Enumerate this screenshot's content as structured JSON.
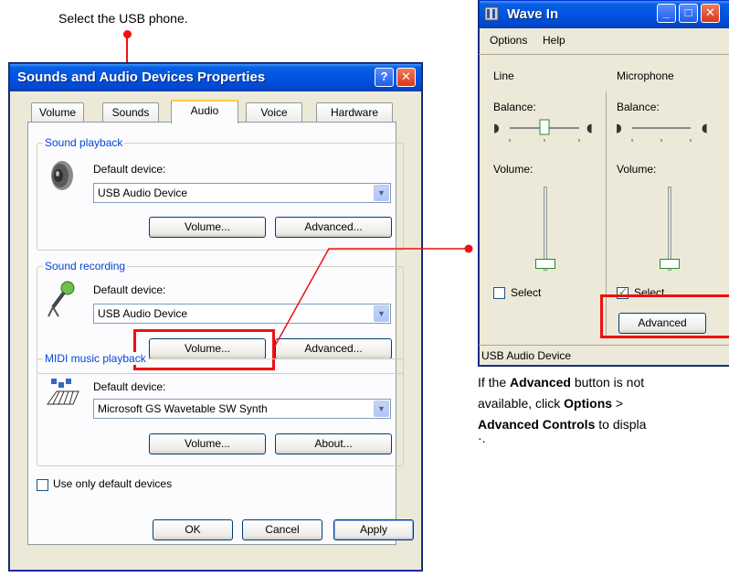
{
  "callouts": {
    "top_instruction": "Select the USB phone.",
    "note_parts": {
      "p1": "If the ",
      "advanced": "Advanced",
      "p2": " button is not",
      "p3": "available, click ",
      "options": "Options",
      "p4": " >",
      "advanced_controls": "Advanced Controls",
      "p5": " to displa",
      "p6": "·."
    }
  },
  "dialog": {
    "title": "Sounds and Audio Devices Properties",
    "help_btn": "?",
    "close_btn": "✕",
    "tabs": [
      "Volume",
      "Sounds",
      "Audio",
      "Voice",
      "Hardware"
    ],
    "active_tab": "Audio",
    "playback": {
      "label": "Sound playback",
      "default_label": "Default device:",
      "device": "USB Audio Device",
      "volume_btn": "Volume...",
      "advanced_btn": "Advanced..."
    },
    "recording": {
      "label": "Sound recording",
      "default_label": "Default device:",
      "device": "USB Audio Device",
      "volume_btn": "Volume...",
      "advanced_btn": "Advanced..."
    },
    "midi": {
      "label": "MIDI music playback",
      "default_label": "Default device:",
      "device": "Microsoft GS Wavetable SW Synth",
      "volume_btn": "Volume...",
      "about_btn": "About..."
    },
    "use_only_default": "Use only default devices",
    "ok": "OK",
    "cancel": "Cancel",
    "apply": "Apply"
  },
  "wavein": {
    "title": "Wave In",
    "menu": [
      "Options",
      "Help"
    ],
    "col1": {
      "name": "Line",
      "balance": "Balance:",
      "volume": "Volume:",
      "select": "Select",
      "selected": false
    },
    "col2": {
      "name": "Microphone",
      "balance": "Balance:",
      "volume": "Volume:",
      "select": "Select",
      "selected": true,
      "advanced": "Advanced"
    },
    "status": "USB Audio Device"
  },
  "colors": {
    "titlebar": "#0054e3",
    "highlight": "#e11111",
    "group_label": "#0046d5",
    "face": "#ece9d8"
  }
}
